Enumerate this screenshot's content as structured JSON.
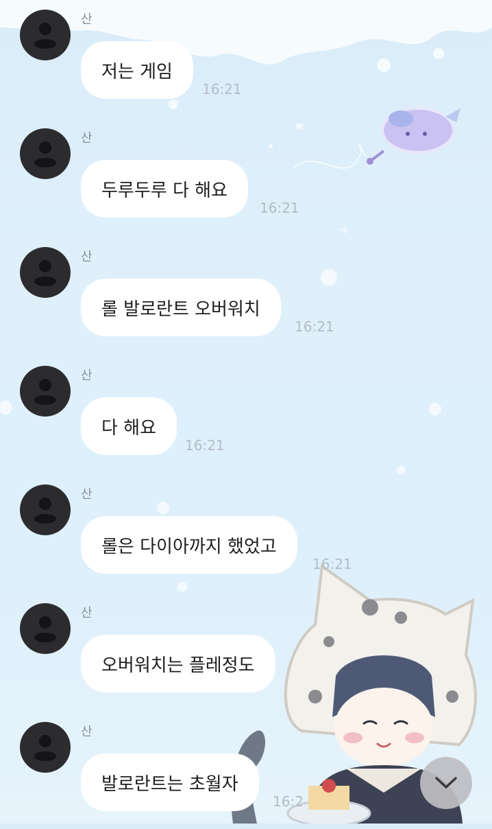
{
  "messages": [
    {
      "sender": "산",
      "text": "저는 게임",
      "time": "16:21"
    },
    {
      "sender": "산",
      "text": "두루두루 다 해요",
      "time": "16:21"
    },
    {
      "sender": "산",
      "text": "롤 발로란트 오버워치",
      "time": "16:21"
    },
    {
      "sender": "산",
      "text": "다 해요",
      "time": "16:21"
    },
    {
      "sender": "산",
      "text": "롤은 다이아까지 했었고",
      "time": "16:21"
    },
    {
      "sender": "산",
      "text": "오버워치는 플레정도",
      "time": ""
    },
    {
      "sender": "산",
      "text": "발로란트는 초월자",
      "time": "16:2"
    }
  ],
  "scroll_button": {
    "icon": "chevron-down-icon"
  },
  "colors": {
    "background": "#dff0fb",
    "bubble": "#ffffff",
    "avatar": "#2c2c2e",
    "time": "#b5bcc3",
    "sender": "#8a9097"
  }
}
